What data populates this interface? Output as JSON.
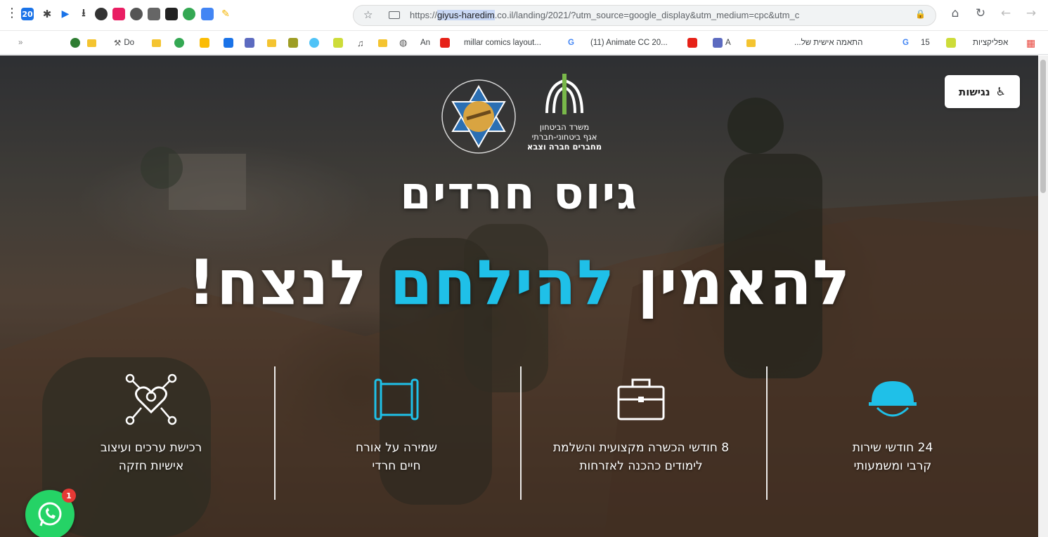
{
  "browser": {
    "url_prefix": "https://",
    "url_host": "giyus-haredim",
    "url_rest": ".co.il/landing/2021/?utm_source=google_display&utm_medium=cpc&utm_c",
    "extension_badge": "20",
    "bookmarks": {
      "do": "Do",
      "an": "An",
      "millar": "millar comics layout...",
      "animate": "(11) Animate CC 20...",
      "a": "A",
      "personal": "התאמה אישית של...",
      "g_num": "15",
      "apps": "אפליקציות"
    }
  },
  "page": {
    "accessibility_label": "נגישות",
    "logo_right_line1": "משרד הביטחון",
    "logo_right_line2": "אגף ביטחוני-חברתי",
    "logo_right_line3": "מחברים חברה וצבא",
    "title_line1": "גיוס חרדים",
    "title_line2_part1": "להאמין",
    "title_line2_part2": "להילחם",
    "title_line2_part3": "לנצח!",
    "features": [
      {
        "line1": "24 חודשי שירות",
        "line2": "קרבי ומשמעותי"
      },
      {
        "line1": "8 חודשי הכשרה מקצועית והשלמת",
        "line2": "לימודים כהכנה לאזרחות"
      },
      {
        "line1": "שמירה על אורח",
        "line2": "חיים חרדי"
      },
      {
        "line1": "רכישת ערכים ועיצוב",
        "line2": "אישיות חזקה"
      }
    ],
    "whatsapp_badge": "1"
  },
  "colors": {
    "accent_cyan": "#1fc0e8",
    "whatsapp_green": "#25d366",
    "badge_red": "#e53935"
  }
}
